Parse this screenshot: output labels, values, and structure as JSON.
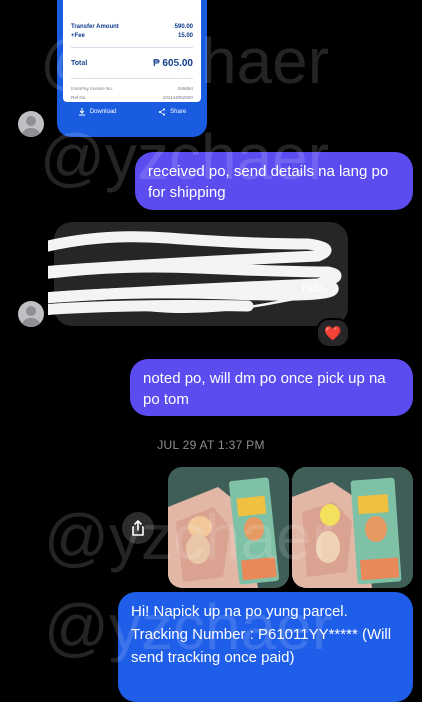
{
  "receipt": {
    "transfer_amount_label": "Transfer Amount",
    "transfer_amount_value": "590.00",
    "fee_label": "+Fee",
    "fee_value": "15.00",
    "total_label": "Total",
    "total_value": "₱ 605.00",
    "invoice_label": "InstaPay Invoice No.",
    "invoice_value": "346654",
    "ref_label": "Ref No.",
    "ref_value": "101144052920",
    "download_label": "Download",
    "share_label": "Share"
  },
  "messages": {
    "msg1": "received po, send details na lang po for shipping",
    "msg2_partial": "ndo.",
    "msg3": "noted po, will dm po once pick up na po tom",
    "msg4": "Hi! Napick up na po yung parcel. Tracking Number : P61011YY***** (Will send tracking once paid)"
  },
  "reaction": "❤️",
  "timestamp": "JUL 29 AT 1:37 PM",
  "watermark": "@yzchaer",
  "colors": {
    "outgoing_bubble": "#5b4cf0",
    "incoming_bubble": "#262629",
    "receipt_blue": "#1a5ce0",
    "last_bubble": "#1e5ee8"
  },
  "icons": {
    "avatar": "person-silhouette",
    "share": "share-icon",
    "download": "download-icon",
    "reaction": "heart"
  }
}
